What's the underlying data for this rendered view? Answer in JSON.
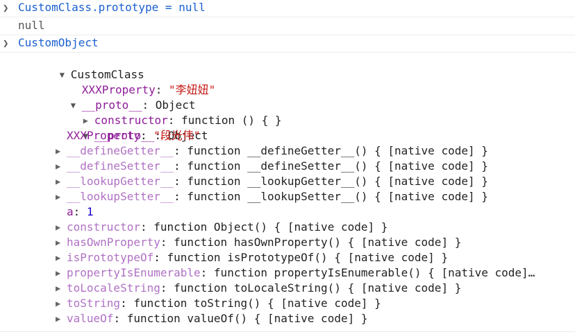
{
  "entries": [
    {
      "command": "CustomClass.prototype = null",
      "result": "null"
    },
    {
      "command": "CustomObject"
    }
  ],
  "tree": {
    "root_label": "CustomClass",
    "root_props": [
      {
        "key": "XXXProperty",
        "sep": ": ",
        "value": "\"李妞妞\"",
        "value_kind": "string"
      }
    ],
    "proto1": {
      "key": "__proto__",
      "sep": ": ",
      "value": "Object"
    },
    "proto1_props": [
      {
        "key": "constructor",
        "sep": ": ",
        "value": "function () { }"
      }
    ],
    "proto2": {
      "key": "__proto__",
      "sep": ": ",
      "value": "Object"
    },
    "proto2_props": [
      {
        "key": "XXXProperty",
        "sep": ": ",
        "value": "\"段光伟\"",
        "value_kind": "string",
        "expandable": false
      },
      {
        "key": "__defineGetter__",
        "sep": ": ",
        "value": "function __defineGetter__() { [native code] }",
        "expandable": true
      },
      {
        "key": "__defineSetter__",
        "sep": ": ",
        "value": "function __defineSetter__() { [native code] }",
        "expandable": true
      },
      {
        "key": "__lookupGetter__",
        "sep": ": ",
        "value": "function __lookupGetter__() { [native code] }",
        "expandable": true
      },
      {
        "key": "__lookupSetter__",
        "sep": ": ",
        "value": "function __lookupSetter__() { [native code] }",
        "expandable": true
      },
      {
        "key": "a",
        "sep": ": ",
        "value": "1",
        "value_kind": "number",
        "expandable": false
      },
      {
        "key": "constructor",
        "sep": ": ",
        "value": "function Object() { [native code] }",
        "expandable": true
      },
      {
        "key": "hasOwnProperty",
        "sep": ": ",
        "value": "function hasOwnProperty() { [native code] }",
        "expandable": true
      },
      {
        "key": "isPrototypeOf",
        "sep": ": ",
        "value": "function isPrototypeOf() { [native code] }",
        "expandable": true
      },
      {
        "key": "propertyIsEnumerable",
        "sep": ": ",
        "value": "function propertyIsEnumerable() { [native code]…",
        "expandable": true
      },
      {
        "key": "toLocaleString",
        "sep": ": ",
        "value": "function toLocaleString() { [native code] }",
        "expandable": true
      },
      {
        "key": "toString",
        "sep": ": ",
        "value": "function toString() { [native code] }",
        "expandable": true
      },
      {
        "key": "valueOf",
        "sep": ": ",
        "value": "function valueOf() { [native code] }",
        "expandable": true
      }
    ]
  },
  "icons": {
    "prompt": "chevron-right-icon",
    "expanded": "triangle-down-icon",
    "collapsed": "triangle-right-icon"
  },
  "colors": {
    "command": "#1a5fcf",
    "result": "#555555",
    "key": "#8e1c99",
    "inherited_key": "#b071c4",
    "string": "#c41a16",
    "number": "#1c00cf"
  }
}
